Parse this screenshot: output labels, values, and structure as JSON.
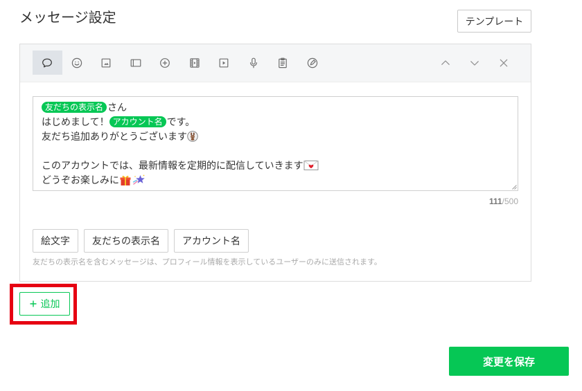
{
  "page": {
    "title": "メッセージ設定"
  },
  "colors": {
    "accent": "#06c755",
    "highlight": "#e60012",
    "text": "#333333",
    "muted": "#999999"
  },
  "template_button": {
    "label": "テンプレート"
  },
  "toolbar": {
    "tools": [
      {
        "icon": "speech-bubble-icon",
        "selected": true
      },
      {
        "icon": "smiley-icon"
      },
      {
        "icon": "image-icon"
      },
      {
        "icon": "ticket-icon"
      },
      {
        "icon": "plus-circle-icon"
      },
      {
        "icon": "film-strip-icon"
      },
      {
        "icon": "play-square-icon"
      },
      {
        "icon": "microphone-icon"
      },
      {
        "icon": "clipboard-icon"
      },
      {
        "icon": "pen-circle-icon"
      }
    ],
    "controls": [
      "chevron-up-icon",
      "chevron-down-icon",
      "close-icon"
    ]
  },
  "message": {
    "paragraphs": [
      {
        "lines": [
          {
            "token": "友だちの表示名",
            "text": "さん"
          },
          {
            "text_before": "はじめまして！",
            "token": "アカウント名",
            "text_after": "です。"
          },
          {
            "text": "友だち追加ありがとうございます",
            "emoji": [
              "bunny-emoji-icon"
            ]
          }
        ]
      },
      {
        "lines": [
          {
            "text": "このアカウントでは、最新情報を定期的に配信していきます",
            "emoji": [
              "envelope-heart-icon"
            ]
          },
          {
            "text": "どうぞお楽しみに",
            "emoji": [
              "gift-icon",
              "sparkle-star-icon"
            ]
          }
        ]
      }
    ],
    "char_count": "111",
    "char_limit": "/500"
  },
  "insert_buttons": [
    {
      "label": "絵文字"
    },
    {
      "label": "友だちの表示名"
    },
    {
      "label": "アカウント名"
    }
  ],
  "note": "友だちの表示名を含むメッセージは、プロフィール情報を表示しているユーザーのみに送信されます。",
  "add_button": {
    "icon": "plus-icon",
    "label": "追加"
  },
  "save_button": {
    "label": "変更を保存"
  }
}
